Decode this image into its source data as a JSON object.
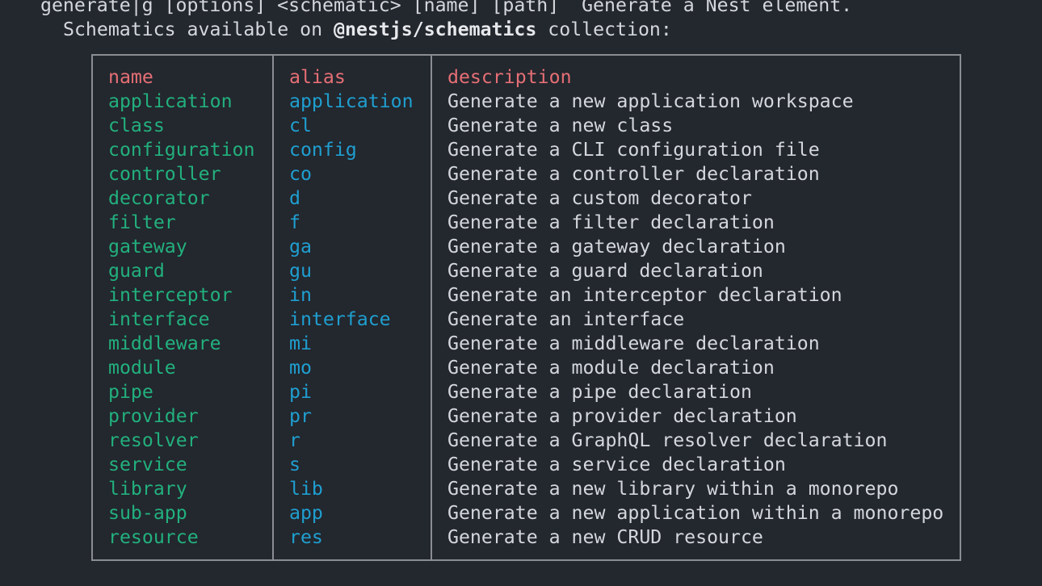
{
  "terminal": {
    "command_line": "generate|g [options] <schematic> [name] [path]  Generate a Nest element.",
    "schematics_prefix": "Schematics available on ",
    "collection_name": "@nestjs/schematics",
    "schematics_suffix": " collection:"
  },
  "colors": {
    "background": "#23272e",
    "header_text": "#e56f75",
    "name_text": "#22b07d",
    "alias_text": "#1f9fd0",
    "description_text": "#d4d7dc",
    "table_border": "#8a8d92"
  },
  "table": {
    "headers": {
      "name": "name",
      "alias": "alias",
      "description": "description"
    },
    "rows": [
      {
        "name": "application",
        "alias": "application",
        "description": "Generate a new application workspace"
      },
      {
        "name": "class",
        "alias": "cl",
        "description": "Generate a new class"
      },
      {
        "name": "configuration",
        "alias": "config",
        "description": "Generate a CLI configuration file"
      },
      {
        "name": "controller",
        "alias": "co",
        "description": "Generate a controller declaration"
      },
      {
        "name": "decorator",
        "alias": "d",
        "description": "Generate a custom decorator"
      },
      {
        "name": "filter",
        "alias": "f",
        "description": "Generate a filter declaration"
      },
      {
        "name": "gateway",
        "alias": "ga",
        "description": "Generate a gateway declaration"
      },
      {
        "name": "guard",
        "alias": "gu",
        "description": "Generate a guard declaration"
      },
      {
        "name": "interceptor",
        "alias": "in",
        "description": "Generate an interceptor declaration"
      },
      {
        "name": "interface",
        "alias": "interface",
        "description": "Generate an interface"
      },
      {
        "name": "middleware",
        "alias": "mi",
        "description": "Generate a middleware declaration"
      },
      {
        "name": "module",
        "alias": "mo",
        "description": "Generate a module declaration"
      },
      {
        "name": "pipe",
        "alias": "pi",
        "description": "Generate a pipe declaration"
      },
      {
        "name": "provider",
        "alias": "pr",
        "description": "Generate a provider declaration"
      },
      {
        "name": "resolver",
        "alias": "r",
        "description": "Generate a GraphQL resolver declaration"
      },
      {
        "name": "service",
        "alias": "s",
        "description": "Generate a service declaration"
      },
      {
        "name": "library",
        "alias": "lib",
        "description": "Generate a new library within a monorepo"
      },
      {
        "name": "sub-app",
        "alias": "app",
        "description": "Generate a new application within a monorepo"
      },
      {
        "name": "resource",
        "alias": "res",
        "description": "Generate a new CRUD resource"
      }
    ]
  }
}
